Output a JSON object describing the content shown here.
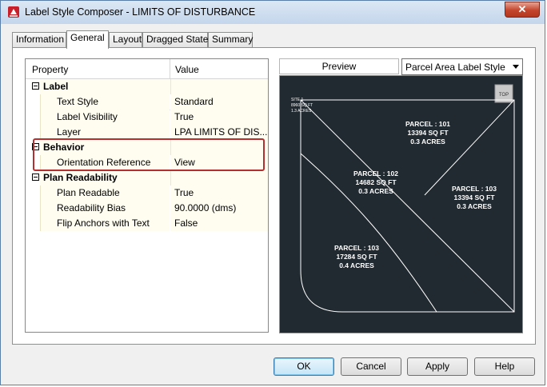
{
  "window": {
    "title": "Label Style Composer - LIMITS OF DISTURBANCE",
    "close_symbol": "✕"
  },
  "tabs": [
    {
      "label": "Information"
    },
    {
      "label": "General",
      "active": true
    },
    {
      "label": "Layout"
    },
    {
      "label": "Dragged State"
    },
    {
      "label": "Summary"
    }
  ],
  "grid": {
    "col_property": "Property",
    "col_value": "Value",
    "categories": [
      {
        "label": "Label",
        "rows": [
          {
            "name": "Text Style",
            "value": "Standard"
          },
          {
            "name": "Label Visibility",
            "value": "True"
          },
          {
            "name": "Layer",
            "value": "LPA LIMITS OF DIS..."
          }
        ]
      },
      {
        "label": "Behavior",
        "rows": [
          {
            "name": "Orientation Reference",
            "value": "View"
          }
        ]
      },
      {
        "label": "Plan Readability",
        "rows": [
          {
            "name": "Plan Readable",
            "value": "True"
          },
          {
            "name": "Readability Bias",
            "value": "90.0000 (dms)"
          },
          {
            "name": "Flip Anchors with Text",
            "value": "False"
          }
        ]
      }
    ]
  },
  "preview": {
    "label": "Preview",
    "style_selected": "Parcel Area Label Style",
    "view_cube": "TOP",
    "corner_label": [
      "SITE 1",
      "8960 SQ FT",
      "1.3 ACRES"
    ],
    "parcels": [
      {
        "lines": [
          "PARCEL : 101",
          "13394 SQ FT",
          "0.3 ACRES"
        ]
      },
      {
        "lines": [
          "PARCEL : 102",
          "14682 SQ FT",
          "0.3 ACRES"
        ]
      },
      {
        "lines": [
          "PARCEL : 103",
          "13394 SQ FT",
          "0.3 ACRES"
        ]
      },
      {
        "lines": [
          "PARCEL : 103",
          "17284 SQ FT",
          "0.4 ACRES"
        ]
      }
    ]
  },
  "buttons": {
    "ok": "OK",
    "cancel": "Cancel",
    "apply": "Apply",
    "help": "Help"
  },
  "colors": {
    "highlight_border": "#b42f2f",
    "preview_bg": "#222a31",
    "close_button": "#c4452c"
  }
}
